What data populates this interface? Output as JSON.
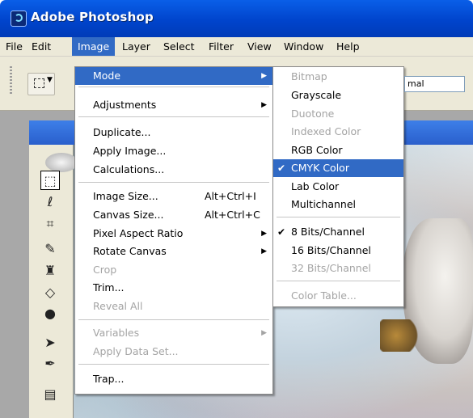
{
  "window": {
    "title": "Adobe Photoshop"
  },
  "menubar": {
    "items": [
      "File",
      "Edit",
      "Image",
      "Layer",
      "Select",
      "Filter",
      "View",
      "Window",
      "Help"
    ],
    "active": "Image"
  },
  "options_bar": {
    "mode_value": "mal"
  },
  "image_menu": {
    "items": [
      {
        "label": "Mode",
        "shortcut": "",
        "submenu": true,
        "enabled": true,
        "highlighted": true
      },
      {
        "label": "Adjustments",
        "shortcut": "",
        "submenu": true,
        "enabled": true
      },
      {
        "label": "Duplicate...",
        "shortcut": "",
        "submenu": false,
        "enabled": true
      },
      {
        "label": "Apply Image...",
        "shortcut": "",
        "submenu": false,
        "enabled": true
      },
      {
        "label": "Calculations...",
        "shortcut": "",
        "submenu": false,
        "enabled": true
      },
      {
        "label": "Image Size...",
        "shortcut": "Alt+Ctrl+I",
        "submenu": false,
        "enabled": true
      },
      {
        "label": "Canvas Size...",
        "shortcut": "Alt+Ctrl+C",
        "submenu": false,
        "enabled": true
      },
      {
        "label": "Pixel Aspect Ratio",
        "shortcut": "",
        "submenu": true,
        "enabled": true
      },
      {
        "label": "Rotate Canvas",
        "shortcut": "",
        "submenu": true,
        "enabled": true
      },
      {
        "label": "Crop",
        "shortcut": "",
        "submenu": false,
        "enabled": false
      },
      {
        "label": "Trim...",
        "shortcut": "",
        "submenu": false,
        "enabled": true
      },
      {
        "label": "Reveal All",
        "shortcut": "",
        "submenu": false,
        "enabled": false
      },
      {
        "label": "Variables",
        "shortcut": "",
        "submenu": true,
        "enabled": false
      },
      {
        "label": "Apply Data Set...",
        "shortcut": "",
        "submenu": false,
        "enabled": false
      },
      {
        "label": "Trap...",
        "shortcut": "",
        "submenu": false,
        "enabled": true
      }
    ]
  },
  "mode_menu": {
    "items": [
      {
        "label": "Bitmap",
        "enabled": false,
        "checked": false
      },
      {
        "label": "Grayscale",
        "enabled": true,
        "checked": false
      },
      {
        "label": "Duotone",
        "enabled": false,
        "checked": false
      },
      {
        "label": "Indexed Color",
        "enabled": false,
        "checked": false
      },
      {
        "label": "RGB Color",
        "enabled": true,
        "checked": false
      },
      {
        "label": "CMYK Color",
        "enabled": true,
        "checked": true,
        "highlighted": true
      },
      {
        "label": "Lab Color",
        "enabled": true,
        "checked": false
      },
      {
        "label": "Multichannel",
        "enabled": true,
        "checked": false
      },
      {
        "label": "8 Bits/Channel",
        "enabled": true,
        "checked": true
      },
      {
        "label": "16 Bits/Channel",
        "enabled": true,
        "checked": false
      },
      {
        "label": "32 Bits/Channel",
        "enabled": false,
        "checked": false
      },
      {
        "label": "Color Table...",
        "enabled": false,
        "checked": false
      }
    ]
  },
  "icons": {
    "app": "photoshop-app-icon",
    "submenu": "submenu-arrow-icon",
    "check": "checkmark-icon"
  },
  "colors": {
    "titlebar": "#0044cc",
    "menu_highlight": "#316ac5",
    "disabled_text": "#a4a4a4",
    "chrome": "#ece9d8"
  }
}
